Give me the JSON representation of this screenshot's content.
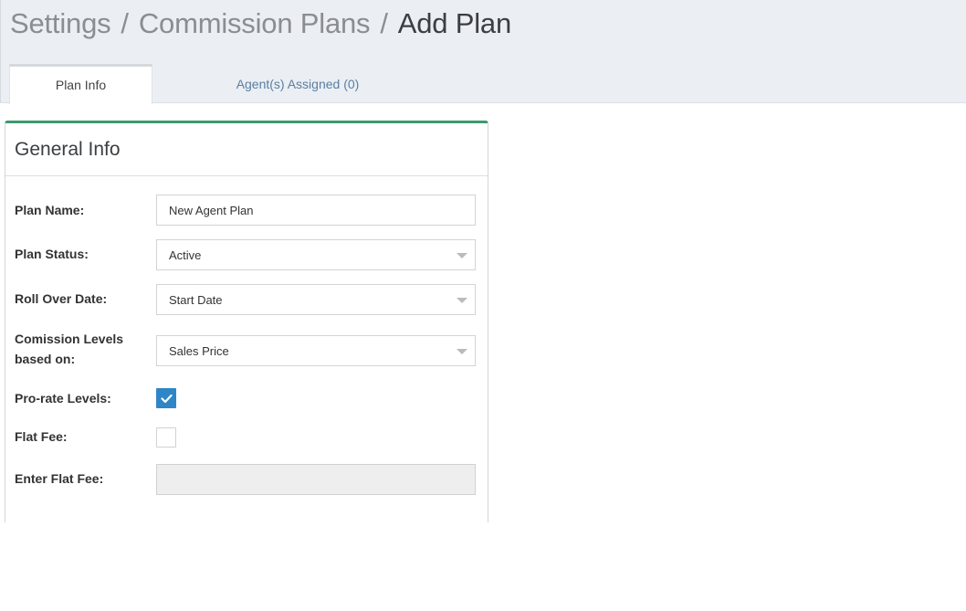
{
  "breadcrumb": {
    "items": [
      "Settings",
      "Commission Plans"
    ],
    "separator": "/",
    "current": "Add Plan"
  },
  "tabs": [
    {
      "label": "Plan Info",
      "active": true
    },
    {
      "label": "Agent(s) Assigned (0)",
      "active": false
    }
  ],
  "card": {
    "title": "General Info",
    "accent_color": "#3d9970"
  },
  "form": {
    "plan_name": {
      "label": "Plan Name:",
      "value": "New Agent Plan"
    },
    "plan_status": {
      "label": "Plan Status:",
      "value": "Active"
    },
    "roll_over_date": {
      "label": "Roll Over Date:",
      "value": "Start Date"
    },
    "commission_levels": {
      "label_line1": "Comission Levels",
      "label_line2": "based on:",
      "value": "Sales Price"
    },
    "pro_rate_levels": {
      "label": "Pro-rate Levels:",
      "checked": true
    },
    "flat_fee": {
      "label": "Flat Fee:",
      "checked": false
    },
    "enter_flat_fee": {
      "label": "Enter Flat Fee:",
      "value": "",
      "disabled": true
    }
  },
  "colors": {
    "checkbox_checked": "#2e86c6",
    "tab_inactive_text": "#5a7fa3",
    "header_bg": "#ebeef3"
  }
}
